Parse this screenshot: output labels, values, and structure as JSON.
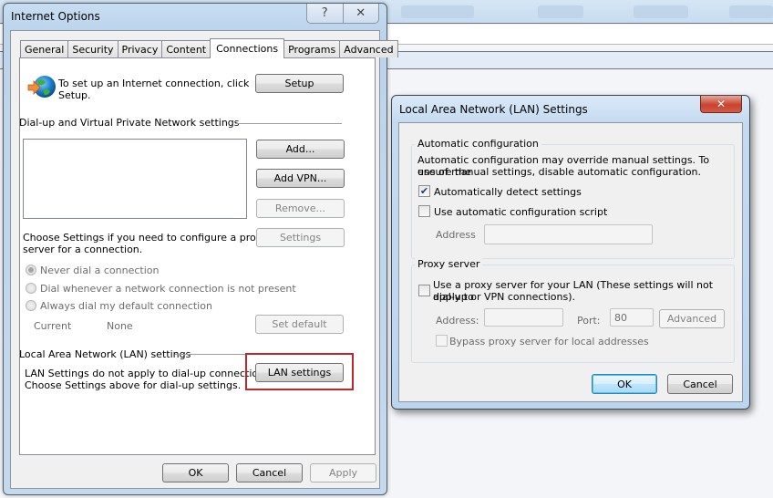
{
  "internet_options": {
    "title": "Internet Options",
    "caption": {
      "help_icon": "?",
      "close_icon": "✕"
    },
    "tabs": [
      {
        "label": "General",
        "active": false
      },
      {
        "label": "Security",
        "active": false
      },
      {
        "label": "Privacy",
        "active": false
      },
      {
        "label": "Content",
        "active": false
      },
      {
        "label": "Connections",
        "active": true
      },
      {
        "label": "Programs",
        "active": false
      },
      {
        "label": "Advanced",
        "active": false
      }
    ],
    "setup": {
      "icon": "globe-arrow-icon",
      "text_line1": "To set up an Internet connection, click",
      "text_line2": "Setup.",
      "button": "Setup"
    },
    "dialup": {
      "heading": "Dial-up and Virtual Private Network settings",
      "connections": [],
      "add_button": "Add...",
      "add_vpn_button": "Add VPN...",
      "remove_button": "Remove...",
      "proxy_text_line1": "Choose Settings if you need to configure a proxy",
      "proxy_text_line2": "server for a connection.",
      "settings_button": "Settings",
      "radio_options": [
        {
          "label": "Never dial a connection",
          "selected": true
        },
        {
          "label": "Dial whenever a network connection is not present",
          "selected": false
        },
        {
          "label": "Always dial my default connection",
          "selected": false
        }
      ],
      "current_label": "Current",
      "current_value": "None",
      "set_default_button": "Set default"
    },
    "lan": {
      "heading": "Local Area Network (LAN) settings",
      "text_line1": "LAN Settings do not apply to dial-up connections.",
      "text_line2": "Choose Settings above for dial-up settings.",
      "button": "LAN settings",
      "highlight_color": "#c0272d"
    },
    "footer": {
      "ok": "OK",
      "cancel": "Cancel",
      "apply": "Apply"
    }
  },
  "lan_dialog": {
    "title": "Local Area Network (LAN) Settings",
    "close_icon": "✕",
    "auto_config": {
      "heading": "Automatic configuration",
      "description_line1": "Automatic configuration may override manual settings.  To ensure the",
      "description_line2": "use of manual settings, disable automatic configuration.",
      "auto_detect_label": "Automatically detect settings",
      "auto_detect_checked": true,
      "script_label": "Use automatic configuration script",
      "script_checked": false,
      "address_label": "Address",
      "address_value": ""
    },
    "proxy": {
      "heading": "Proxy server",
      "use_proxy_line1": "Use a proxy server for your LAN (These settings will not apply to",
      "use_proxy_line2": "dial-up or VPN connections).",
      "use_proxy_checked": false,
      "address_label": "Address:",
      "address_value": "",
      "port_label": "Port:",
      "port_value": "80",
      "advanced_button": "Advanced",
      "bypass_label": "Bypass proxy server for local addresses",
      "bypass_checked": false
    },
    "footer": {
      "ok": "OK",
      "cancel": "Cancel"
    }
  }
}
